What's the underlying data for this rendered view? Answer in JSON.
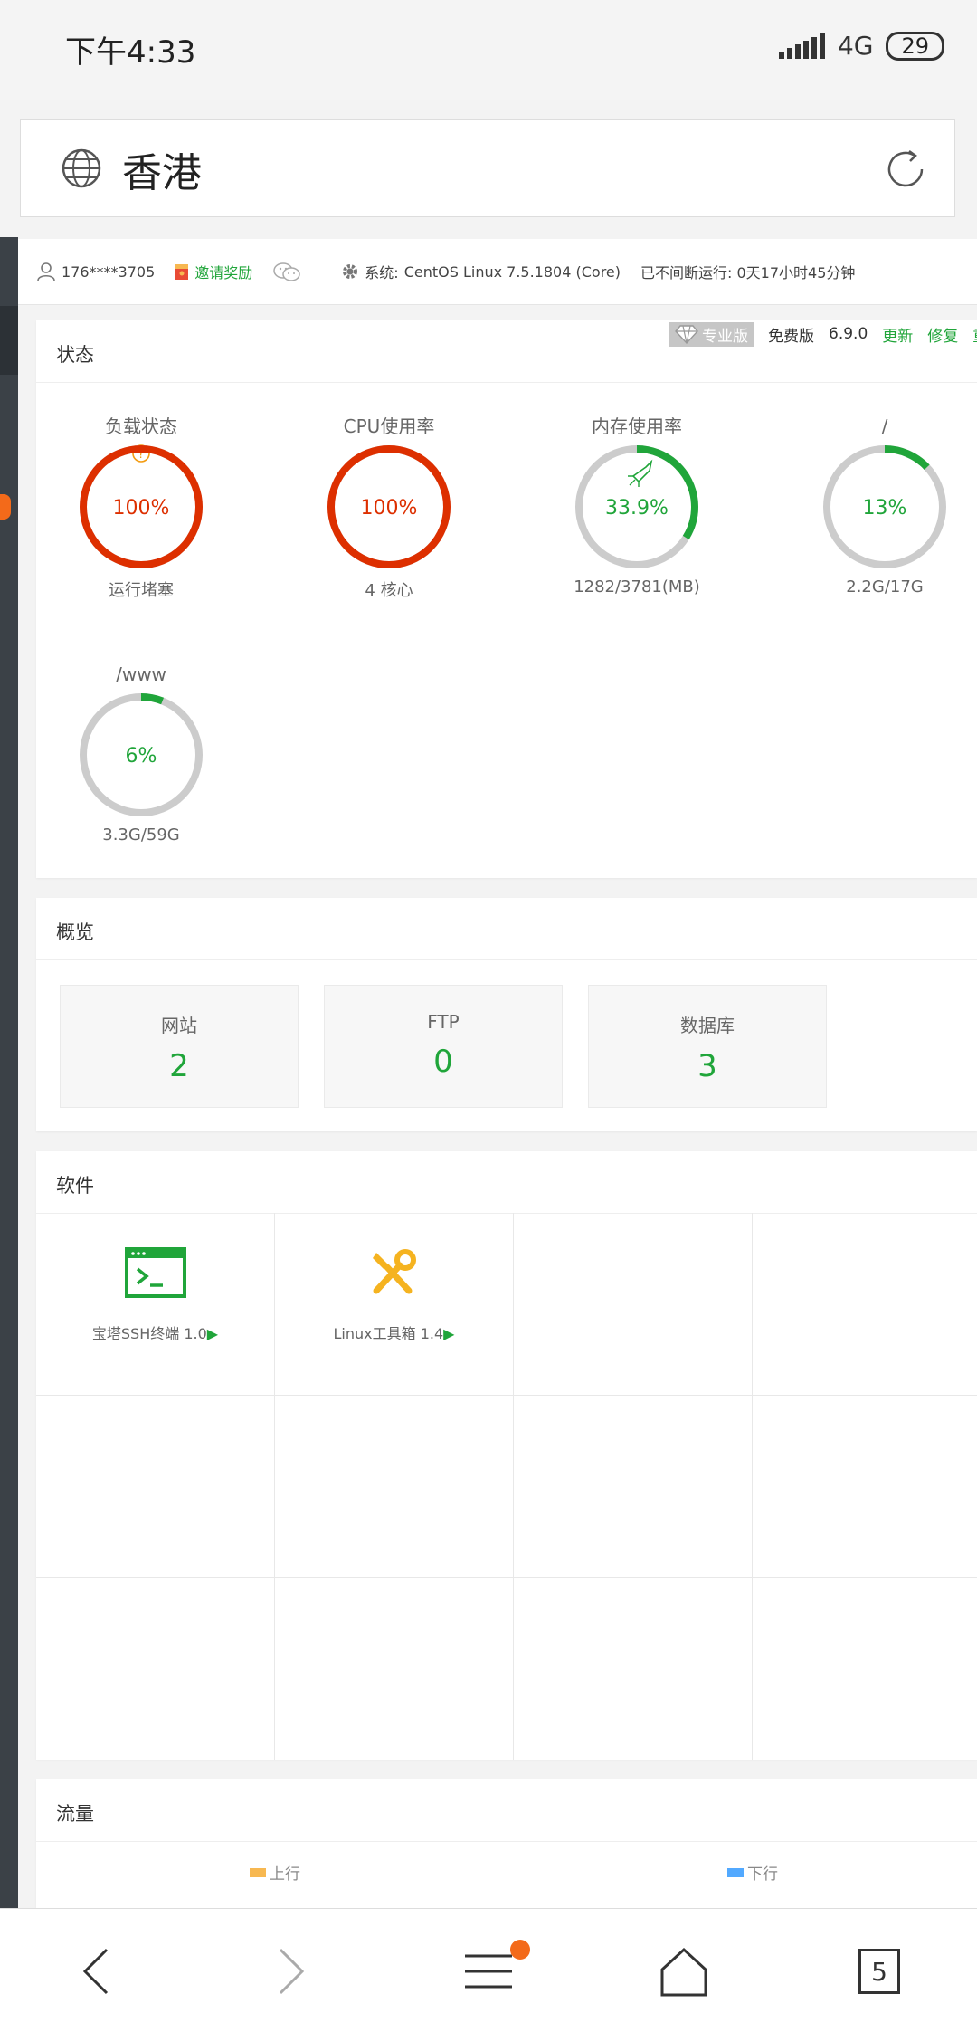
{
  "status_bar": {
    "time": "下午4:33",
    "network": "4G",
    "battery": "29"
  },
  "url_bar": {
    "title": "香港"
  },
  "info_row": {
    "user": "176****3705",
    "invite": "邀请奖励",
    "system_label": "系统:",
    "system_value": "CentOS Linux 7.5.1804 (Core)",
    "uptime": "已不间断运行: 0天17小时45分钟"
  },
  "version_bar": {
    "pro_badge": "专业版",
    "edition": "免费版",
    "version": "6.9.0",
    "update": "更新",
    "repair": "修复",
    "restart": "重启"
  },
  "status_card": {
    "title": "状态",
    "gauges": [
      {
        "title": "负载状态",
        "value": "100%",
        "sub": "运行堵塞",
        "percent": 100,
        "color": "#dd2f00",
        "help": "?"
      },
      {
        "title": "CPU使用率",
        "value": "100%",
        "sub": "4 核心",
        "percent": 100,
        "color": "#dd2f00"
      },
      {
        "title": "内存使用率",
        "value": "33.9%",
        "sub": "1282/3781(MB)",
        "percent": 33.9,
        "color": "#20a53a"
      },
      {
        "title": "/",
        "value": "13%",
        "sub": "2.2G/17G",
        "percent": 13,
        "color": "#20a53a"
      },
      {
        "title": "/www",
        "value": "6%",
        "sub": "3.3G/59G",
        "percent": 6,
        "color": "#20a53a"
      }
    ]
  },
  "overview_card": {
    "title": "概览",
    "items": [
      {
        "label": "网站",
        "value": "2"
      },
      {
        "label": "FTP",
        "value": "0"
      },
      {
        "label": "数据库",
        "value": "3"
      }
    ]
  },
  "software_card": {
    "title": "软件",
    "items": [
      {
        "name": "宝塔SSH终端 1.0",
        "icon": "terminal-icon"
      },
      {
        "name": "Linux工具箱 1.4",
        "icon": "tools-icon"
      }
    ]
  },
  "traffic_card": {
    "title": "流量",
    "up_label": "上行",
    "down_label": "下行",
    "up_color": "#f7b851",
    "down_color": "#52a9ff"
  },
  "nav": {
    "tabs_count": "5"
  },
  "colors": {
    "accent": "#20a53a",
    "danger": "#dd2f00",
    "badge": "#f36a1a"
  }
}
